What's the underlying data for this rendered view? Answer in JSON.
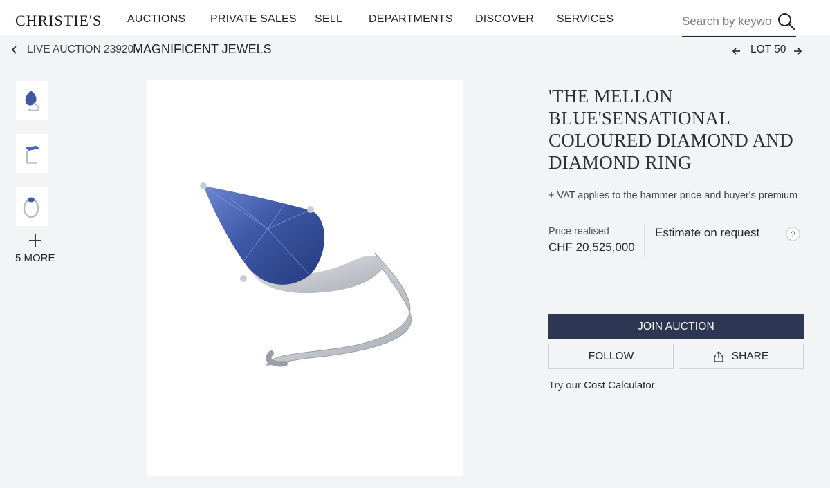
{
  "header": {
    "logo": "CHRISTIE'S",
    "nav": [
      "AUCTIONS",
      "PRIVATE SALES",
      "SELL",
      "DEPARTMENTS",
      "DISCOVER",
      "SERVICES"
    ],
    "search_placeholder": "Search by keywor"
  },
  "breadcrumb": {
    "sub": "LIVE AUCTION 23920",
    "title": "MAGNIFICENT JEWELS",
    "lot": "LOT 50"
  },
  "thumbnails": {
    "items": [
      "ring-front-view",
      "ring-side-view",
      "ring-top-view"
    ],
    "more_label": "5 MORE"
  },
  "lot": {
    "title": "'THE MELLON BLUE'SENSATIONAL COLOURED DIAMOND AND DIAMOND RING",
    "vat_note": "+ VAT applies to the hammer price and buyer's premium",
    "price_label": "Price realised",
    "price_value": "CHF 20,525,000",
    "estimate": "Estimate on request"
  },
  "actions": {
    "join": "JOIN AUCTION",
    "follow": "FOLLOW",
    "share": "SHARE",
    "calc_prefix": "Try our",
    "calc_link": "Cost Calculator"
  },
  "colors": {
    "primary_button": "#2d3754",
    "background": "#f3f4f6",
    "diamond_blue": "#3e58a6"
  }
}
